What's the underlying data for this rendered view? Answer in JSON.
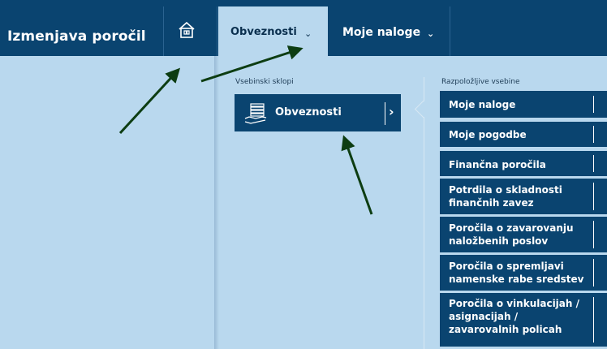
{
  "header": {
    "app_title": "Izmenjava poročil",
    "tabs": [
      {
        "label": "Obveznosti",
        "active": true
      },
      {
        "label": "Moje naloge",
        "active": false
      }
    ],
    "chevron": "⌄"
  },
  "menu": {
    "left_section_title": "Vsebinski sklopi",
    "right_section_title": "Razpoložljive vsebine",
    "category": {
      "label": "Obveznosti",
      "icon": "hand-documents-icon"
    },
    "items": [
      {
        "label": "Moje naloge"
      },
      {
        "label": "Moje pogodbe"
      },
      {
        "label": "Finančna poročila"
      },
      {
        "label": "Potrdila o skladnosti finančnih zavez"
      },
      {
        "label": "Poročila o zavarovanju naložbenih poslov"
      },
      {
        "label": "Poročila o spremljavi namenske rabe sredstev"
      },
      {
        "label": "Poročila o vinkulacijah / asignacijah / zavarovalnih policah"
      }
    ]
  },
  "colors": {
    "navy": "#0a4470",
    "panel": "#b9d8ee",
    "annotation_arrow": "#0d3d12"
  }
}
